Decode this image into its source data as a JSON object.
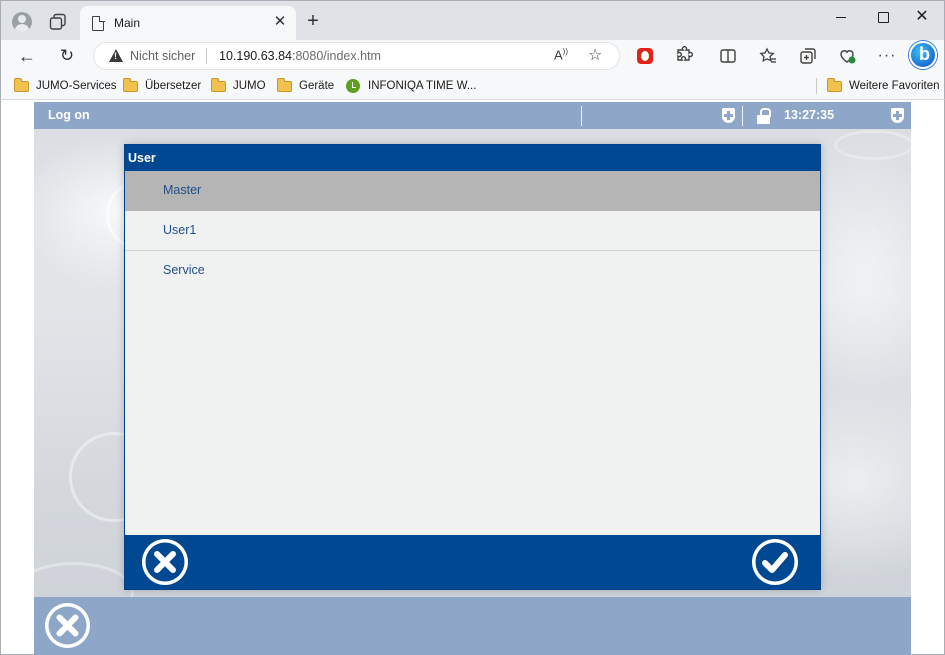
{
  "browser": {
    "tab_title": "Main",
    "tab_close": "✕",
    "new_tab": "+",
    "address": {
      "insecure_label": "Nicht sicher",
      "url_host": "10.190.63.84",
      "url_rest": ":8080/index.htm"
    },
    "favorites": [
      {
        "label": "JUMO-Services",
        "icon": "folder-icon"
      },
      {
        "label": "Übersetzer",
        "icon": "folder-icon"
      },
      {
        "label": "JUMO",
        "icon": "folder-icon"
      },
      {
        "label": "Geräte",
        "icon": "folder-icon"
      },
      {
        "label": "INFONIQA TIME W...",
        "icon": "clock-icon"
      }
    ],
    "other_favorites": "Weitere Favoriten"
  },
  "app": {
    "title": "Log on",
    "time": "13:27:35",
    "header_icons": [
      "shield-plus-icon",
      "lock-icon",
      "shield-plus-icon"
    ],
    "colors": {
      "header": "#8ea6c8",
      "dialog_header": "#004891",
      "selected_row": "#b5b5b5",
      "item_text": "#1e4f8c"
    }
  },
  "dialog": {
    "title": "User",
    "items": [
      {
        "label": "Master",
        "selected": true
      },
      {
        "label": "User1",
        "selected": false
      },
      {
        "label": "Service",
        "selected": false
      }
    ],
    "cancel_icon": "cancel-x-icon",
    "confirm_icon": "checkmark-icon"
  }
}
